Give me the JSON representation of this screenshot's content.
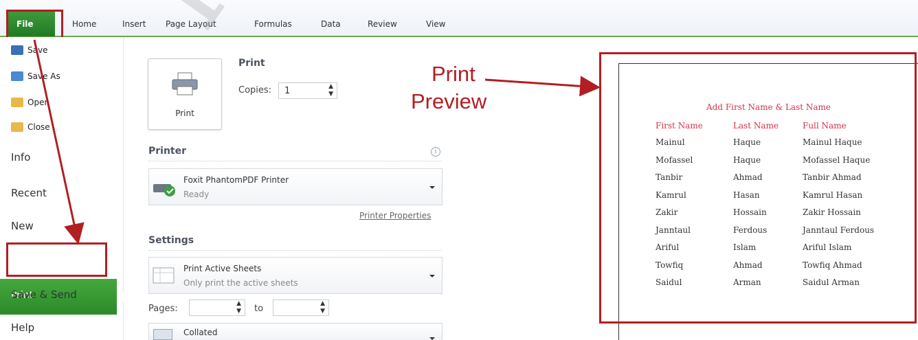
{
  "ribbon": {
    "tabs": [
      "File",
      "Home",
      "Insert",
      "Page Layout",
      "Formulas",
      "Data",
      "Review",
      "View"
    ]
  },
  "nav": {
    "small_items": [
      "Save",
      "Save As",
      "Open",
      "Close"
    ],
    "items": [
      "Info",
      "Recent",
      "New",
      "Print",
      "Save & Send",
      "Help"
    ],
    "selected": "Print"
  },
  "print": {
    "title": "Print",
    "button_label": "Print",
    "copies_label": "Copies:",
    "copies_value": "1"
  },
  "printer": {
    "section_title": "Printer",
    "name": "Foxit PhantomPDF Printer",
    "status": "Ready",
    "properties_link": "Printer Properties"
  },
  "settings": {
    "section_title": "Settings",
    "active_sheets_title": "Print Active Sheets",
    "active_sheets_desc": "Only print the active sheets",
    "pages_label": "Pages:",
    "to_label": "to",
    "collated_label": "Collated"
  },
  "annotation": {
    "line1": "Print",
    "line2": "Preview"
  },
  "preview": {
    "title": "Add First Name & Last Name",
    "headers": [
      "First Name",
      "Last Name",
      "Full Name"
    ],
    "rows": [
      [
        "Mainul",
        "Haque",
        "Mainul Haque"
      ],
      [
        "Mofassel",
        "Haque",
        "Mofassel Haque"
      ],
      [
        "Tanbir",
        "Ahmad",
        "Tanbir Ahmad"
      ],
      [
        "Kamrul",
        "Hasan",
        "Kamrul Hasan"
      ],
      [
        "Zakir",
        "Hossain",
        "Zakir Hossain"
      ],
      [
        "Janntaul",
        "Ferdous",
        "Janntaul Ferdous"
      ],
      [
        "Ariful",
        "Islam",
        "Ariful Islam"
      ],
      [
        "Towfiq",
        "Ahmad",
        "Towfiq Ahmad"
      ],
      [
        "Saidul",
        "Arman",
        "Saidul Arman"
      ]
    ]
  },
  "colors": {
    "annotation_red": "#b21e22",
    "file_green": "#2b8a28",
    "header_red": "#d8314a"
  },
  "watermark": "hiractg.c"
}
